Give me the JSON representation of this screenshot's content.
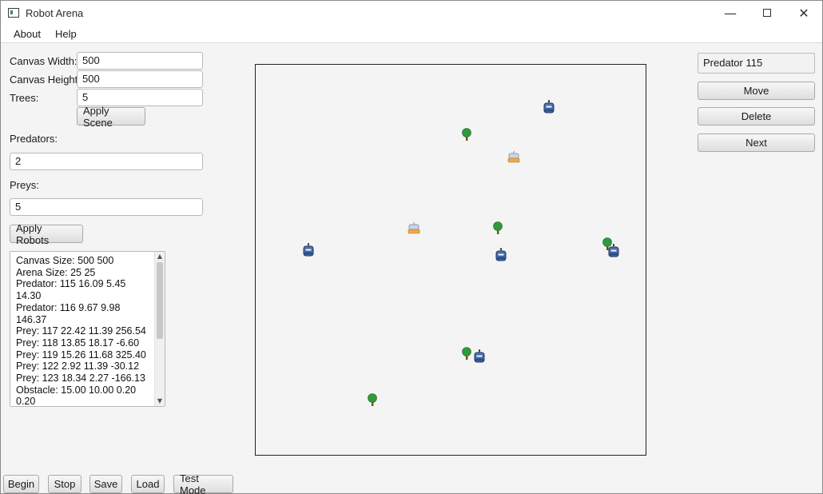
{
  "window": {
    "title": "Robot Arena",
    "controls": {
      "minimize": "—",
      "close": "✕"
    }
  },
  "menu": {
    "items": [
      "About",
      "Help"
    ]
  },
  "scene": {
    "canvas_width_label": "Canvas Width:",
    "canvas_width_value": "500",
    "canvas_height_label": "Canvas Height:",
    "canvas_height_value": "500",
    "trees_label": "Trees:",
    "trees_value": "5",
    "apply_scene": "Apply Scene"
  },
  "robots": {
    "predators_label": "Predators:",
    "predators_value": "2",
    "preys_label": "Preys:",
    "preys_value": "5",
    "apply_robots": "Apply Robots"
  },
  "info_lines": [
    "Canvas Size: 500 500",
    "Arena Size: 25 25",
    "Predator: 115 16.09 5.45",
    "14.30",
    "Predator: 116 9.67 9.98",
    "146.37",
    "Prey: 117 22.42 11.39 256.54",
    "Prey: 118 13.85 18.17 -6.60",
    "Prey: 119 15.26 11.68 325.40",
    "Prey: 122 2.92 11.39 -30.12",
    "Prey: 123 18.34 2.27 -166.13",
    "Obstacle: 15.00 10.00 0.20",
    "0.20"
  ],
  "right_panel": {
    "selected": "Predator 115",
    "move": "Move",
    "delete": "Delete",
    "next": "Next"
  },
  "bottom_buttons": {
    "begin": "Begin",
    "stop": "Stop",
    "save": "Save",
    "load": "Load",
    "test_mode": "Test Mode"
  },
  "arena_objects": [
    {
      "kind": "predator-icon"
    },
    {
      "kind": "predator-icon"
    },
    {
      "kind": "predator-icon"
    },
    {
      "kind": "predator-icon"
    },
    {
      "kind": "predator-icon"
    },
    {
      "kind": "prey-icon"
    },
    {
      "kind": "prey-icon"
    },
    {
      "kind": "tree-icon"
    },
    {
      "kind": "tree-icon"
    },
    {
      "kind": "tree-icon"
    },
    {
      "kind": "tree-icon"
    },
    {
      "kind": "tree-icon"
    }
  ],
  "colors": {
    "predator": "#4a7bc8",
    "prey": "#e9a84a",
    "tree": "#2f9a3a",
    "trunk": "#7a4a23"
  }
}
